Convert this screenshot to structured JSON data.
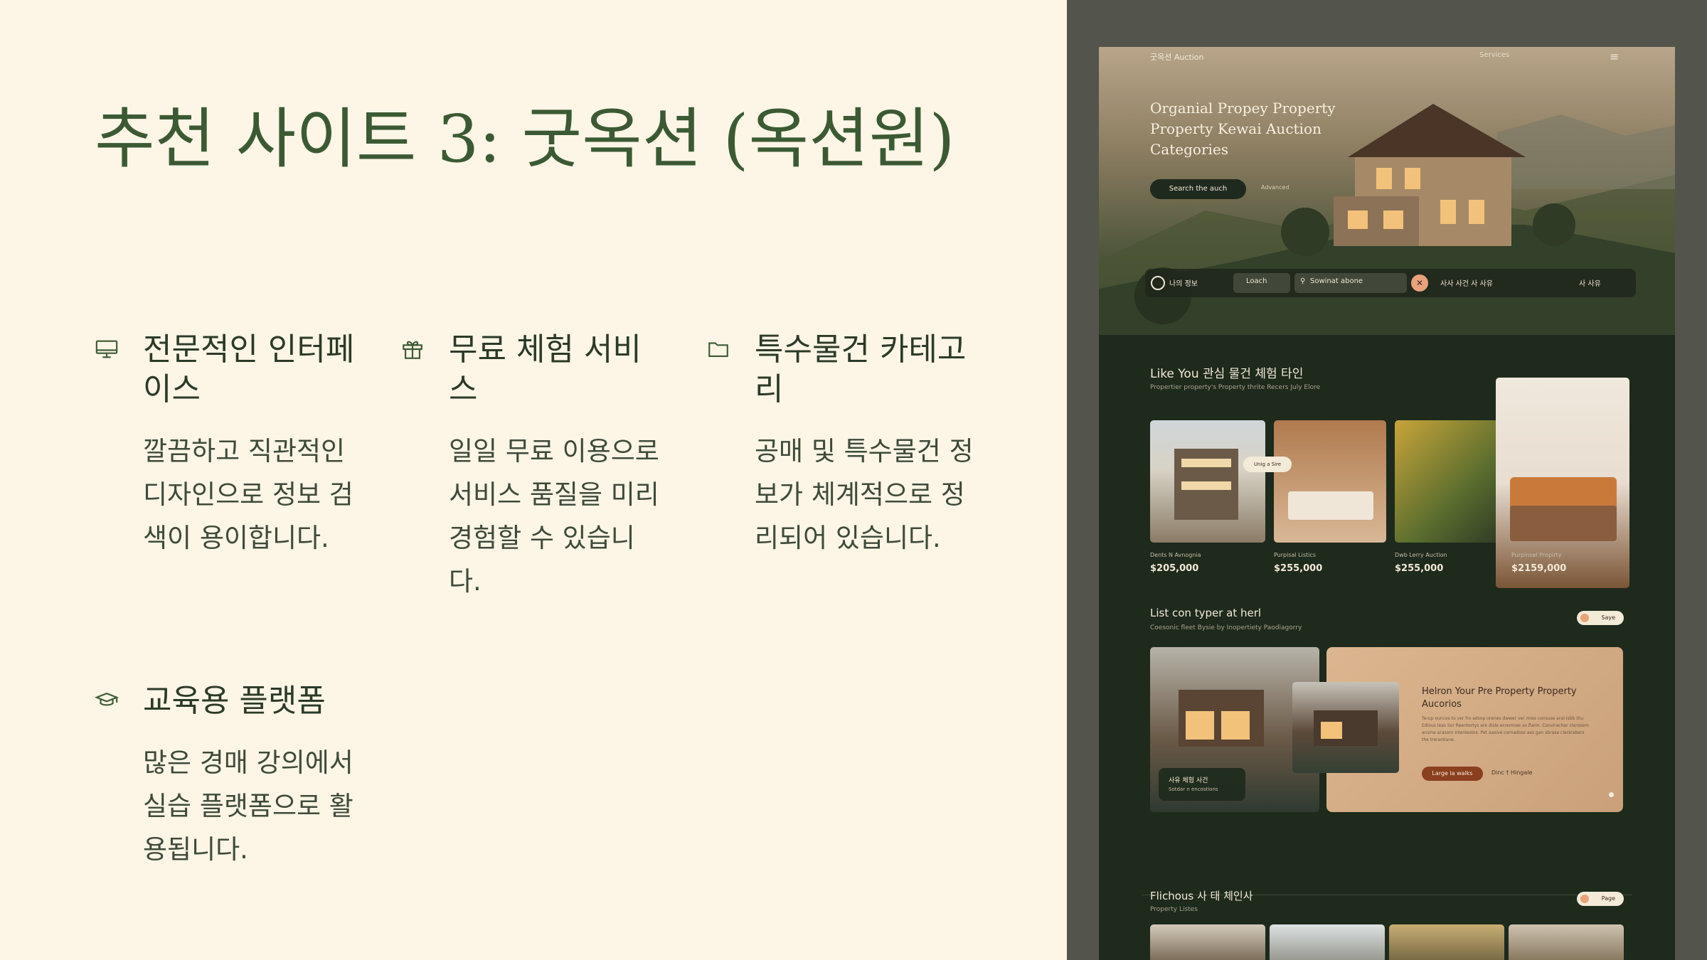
{
  "slide": {
    "title": "추천 사이트 3: 굿옥션 (옥션원)",
    "features": [
      {
        "icon": "monitor-icon",
        "title": "전문적인 인터페이스",
        "desc": "깔끔하고 직관적인 디자인으로 정보 검색이 용이합니다."
      },
      {
        "icon": "gift-icon",
        "title": "무료 체험 서비스",
        "desc": "일일 무료 이용으로 서비스 품질을 미리 경험할 수 있습니다."
      },
      {
        "icon": "folder-icon",
        "title": "특수물건 카테고리",
        "desc": "공매 및 특수물건 정보가 체계적으로 정리되어 있습니다."
      },
      {
        "icon": "graduation-cap-icon",
        "title": "교육용 플랫폼",
        "desc": "많은 경매 강의에서 실습 플랫폼으로 활용됩니다."
      }
    ]
  },
  "mockup": {
    "nav": {
      "logo": "굿옥션 Auction",
      "link": "Services",
      "menu": "≡"
    },
    "hero": {
      "title": "Organial Propey Property Property Kewai Auction Categories",
      "button": "Search the auch",
      "link": "Advanced"
    },
    "search": {
      "user": "나의 정보",
      "field1": "Loach",
      "field2": "Sowinat abone",
      "go": "✕",
      "opt1": "사사 사건 사 사유",
      "opt2": "사 사유"
    },
    "section1": {
      "title": "Like You 관심 물건 체험 타인",
      "subtitle": "Propertier property's Property thrite Recers July Elore",
      "badge": "Unig a Sire",
      "cards": [
        {
          "label": "Dents N Avnognia",
          "price": "$205,000"
        },
        {
          "label": "Purpisal Listics",
          "price": "$255,000"
        },
        {
          "label": "Dwb Lerry Auction",
          "price": "$255,000"
        },
        {
          "label": "Purpinsel Propirty",
          "price": "$2159,000"
        }
      ]
    },
    "section2": {
      "title": "List con typer at herl",
      "subtitle": "Coesonic fleet Bysie by Inopertiety Paodiagorry",
      "pill": "Saye",
      "overlay_title": "사유 체험 사건",
      "overlay_sub": "Sotdar n encostions",
      "promo_title": "Helron Your Pre Property Property Aucorios",
      "promo_text": "Terup ounces to ver fro adsop orenes dwwer ver mies consuse eral Isbb thu Edlous leas Sor Reentertys are disle ecremnes so flarm. Conviracher clerosem ansine arasorn Inlenlestos. Pet aasive cornadoss aes gan sbrase clersrabers the trerarslane.",
      "promo_button": "Large la walks",
      "promo_link": "Dinc † Hingale"
    },
    "section3": {
      "title": "Flichous 사 태 체인사",
      "subtitle": "Property Listes",
      "pill": "Page"
    }
  }
}
